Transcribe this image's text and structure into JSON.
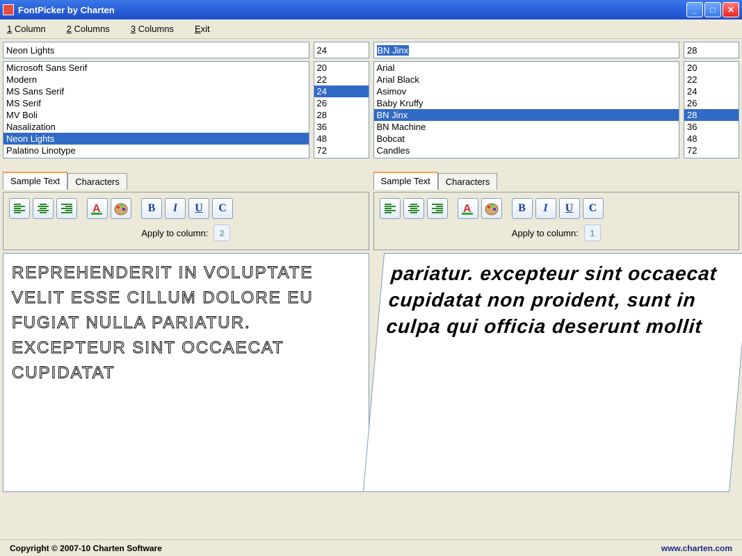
{
  "window": {
    "title": "FontPicker by Charten"
  },
  "menu": {
    "col1": "1 Column",
    "col2": "2 Columns",
    "col3": "3 Columns",
    "exit": "Exit"
  },
  "columns": [
    {
      "font_input": "Neon Lights",
      "font_input_selected": false,
      "size_input": "24",
      "fonts": [
        "Microsoft Sans Serif",
        "Modern",
        "MS Sans Serif",
        "MS Serif",
        "MV Boli",
        "Nasalization",
        "Neon Lights",
        "Palatino Linotype"
      ],
      "font_selected": "Neon Lights",
      "sizes": [
        "20",
        "22",
        "24",
        "26",
        "28",
        "36",
        "48",
        "72"
      ],
      "size_selected": "24",
      "tabs": {
        "sample": "Sample Text",
        "characters": "Characters",
        "active": "sample"
      },
      "apply_label": "Apply to column:",
      "apply_target": "2",
      "preview_text": "reprehenderit in voluptate velit esse cillum dolore eu fugiat nulla pariatur. Excepteur sint occaecat cupidatat"
    },
    {
      "font_input": "BN Jinx",
      "font_input_selected": true,
      "size_input": "28",
      "fonts": [
        "Arial",
        "Arial Black",
        "Asimov",
        "Baby Kruffy",
        "BN Jinx",
        "BN Machine",
        "Bobcat",
        "Candles"
      ],
      "font_selected": "BN Jinx",
      "sizes": [
        "20",
        "22",
        "24",
        "26",
        "28",
        "36",
        "48",
        "72"
      ],
      "size_selected": "28",
      "tabs": {
        "sample": "Sample Text",
        "characters": "Characters",
        "active": "sample"
      },
      "apply_label": "Apply to column:",
      "apply_target": "1",
      "preview_text": "pariatur. Excepteur sint occaecat cupidatat non proident, sunt in culpa qui officia deserunt mollit"
    }
  ],
  "status": {
    "copyright": "Copyright © 2007-10 Charten Software",
    "url": "www.charten.com"
  }
}
